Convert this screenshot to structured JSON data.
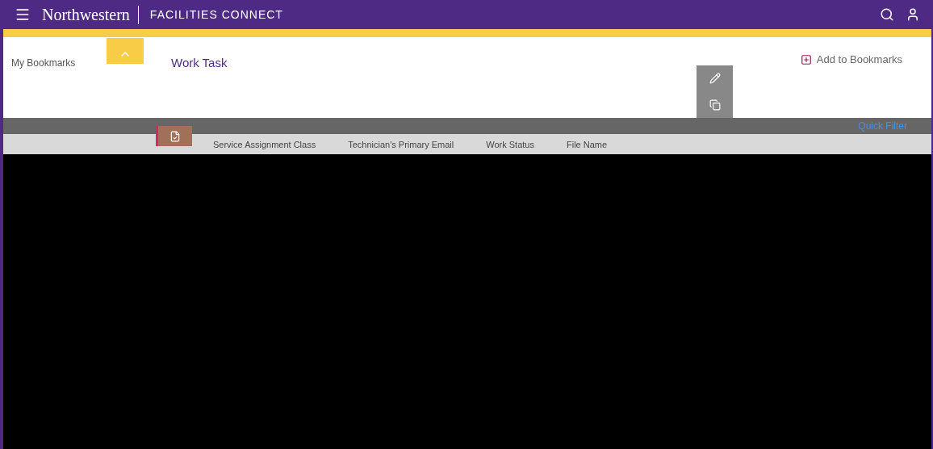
{
  "header": {
    "brand": "Northwestern",
    "product": "FACILITIES CONNECT"
  },
  "breadcrumb": {
    "bookmarks": "My Bookmarks",
    "title": "Work Task",
    "add_bookmark": "Add to Bookmarks"
  },
  "toolbar": {
    "filter": "Quick Filter"
  },
  "table": {
    "columns": [
      "Service Assignment Class",
      "Technician's Primary Email",
      "Work Status",
      "File Name"
    ]
  }
}
